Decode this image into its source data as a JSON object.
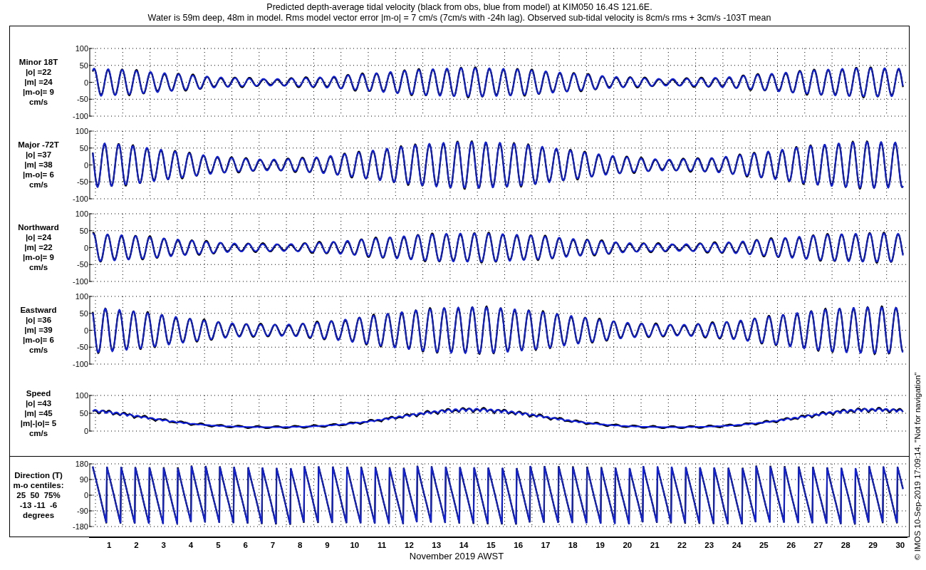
{
  "title": {
    "line_1": "Predicted depth-average tidal velocity (black from obs, blue from model) at KIM050 16.4S 121.6E.",
    "line_2": "Water is 59m deep, 48m in model. Rms model vector error |m-o| = 7 cm/s (7cm/s with -24h lag). Observed sub-tidal velocity is 8cm/s rms + 3cm/s -103T mean"
  },
  "panels": [
    {
      "kind": "signed",
      "label_lines": [
        "Minor 18T",
        "|o| =22",
        "|m| =24",
        "|m-o|= 9",
        "cm/s"
      ],
      "yticks": [
        "100",
        "50",
        "0",
        "-50",
        "-100"
      ]
    },
    {
      "kind": "signed",
      "label_lines": [
        "Major -72T",
        "|o| =37",
        "|m| =38",
        "|m-o|= 6",
        "cm/s"
      ],
      "yticks": [
        "100",
        "50",
        "0",
        "-50",
        "-100"
      ]
    },
    {
      "kind": "signed",
      "label_lines": [
        "Northward",
        "|o| =24",
        "|m| =22",
        "|m-o|= 9",
        "cm/s"
      ],
      "yticks": [
        "100",
        "50",
        "0",
        "-50",
        "-100"
      ]
    },
    {
      "kind": "signed",
      "label_lines": [
        "Eastward",
        "|o| =36",
        "|m| =39",
        "|m-o|= 6",
        "cm/s"
      ],
      "yticks": [
        "100",
        "50",
        "0",
        "-50",
        "-100"
      ]
    },
    {
      "kind": "speed",
      "label_lines": [
        "Speed",
        "|o| =43",
        "|m| =45",
        "|m|-|o|= 5",
        "cm/s"
      ],
      "yticks": [
        "100",
        "50",
        "0"
      ]
    },
    {
      "kind": "direction",
      "label_lines": [
        "Direction (T)",
        "m-o centiles:",
        "25  50  75%",
        "-13 -11  -6",
        "degrees"
      ],
      "yticks": [
        "180",
        "90",
        "0",
        "-90",
        "-180"
      ]
    }
  ],
  "x_axis": {
    "days": [
      "1",
      "2",
      "3",
      "4",
      "5",
      "6",
      "7",
      "8",
      "9",
      "10",
      "11",
      "12",
      "13",
      "14",
      "15",
      "16",
      "17",
      "18",
      "19",
      "20",
      "21",
      "22",
      "23",
      "24",
      "25",
      "26",
      "27",
      "28",
      "29",
      "30"
    ],
    "label": "November 2019 AWST"
  },
  "footer_note": "© IMOS 10-Sep-2019 17:09:14.  \"Not for navigation\""
}
